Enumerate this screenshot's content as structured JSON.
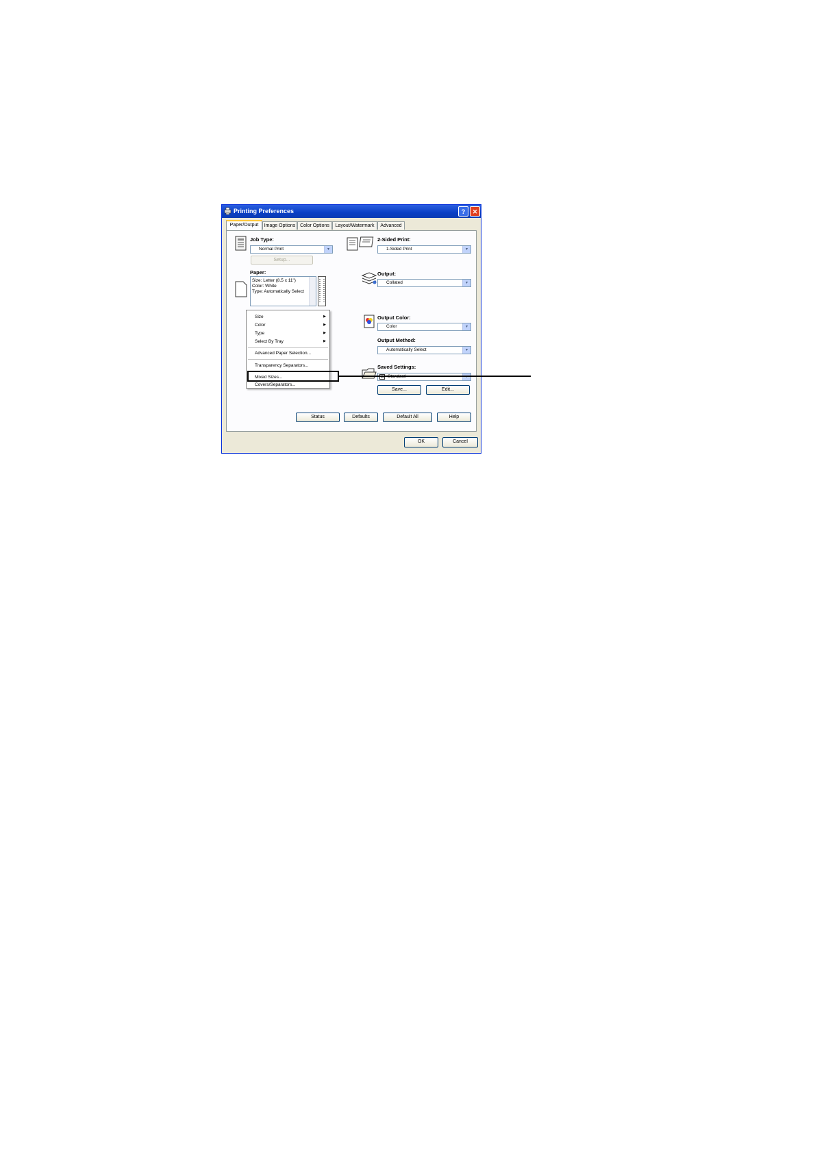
{
  "dialog": {
    "title": "Printing Preferences",
    "help_glyph": "?",
    "close_glyph": "✕"
  },
  "tabs": [
    {
      "label": "Paper/Output",
      "active": true
    },
    {
      "label": "Image Options"
    },
    {
      "label": "Color Options"
    },
    {
      "label": "Layout/Watermark"
    },
    {
      "label": "Advanced"
    }
  ],
  "job_type": {
    "label": "Job Type:",
    "value": "Normal Print",
    "setup_label": "Setup..."
  },
  "two_sided": {
    "label": "2-Sided Print:",
    "value": "1-Sided Print"
  },
  "paper": {
    "label": "Paper:",
    "lines": [
      "Size: Letter (8.5 x 11\")",
      "Color: White",
      "Type: Automatically Select"
    ]
  },
  "output": {
    "label": "Output:",
    "value": "Collated"
  },
  "output_color": {
    "label": "Output Color:",
    "value": "Color"
  },
  "output_method": {
    "label": "Output Method:",
    "value": "Automatically Select"
  },
  "saved_settings": {
    "label": "Saved Settings:",
    "value": "Standard",
    "badge": "A",
    "save_label": "Save...",
    "edit_label": "Edit..."
  },
  "context_menu": {
    "items": [
      {
        "label": "Size",
        "submenu": true
      },
      {
        "label": "Color",
        "submenu": true
      },
      {
        "label": "Type",
        "submenu": true
      },
      {
        "label": "Select By Tray",
        "submenu": true
      },
      {
        "label": "Advanced Paper Selection..."
      },
      {
        "label": "Transparency Separators..."
      },
      {
        "label": "Mixed Sizes...",
        "highlighted_callout": true
      },
      {
        "label": "Covers/Separators..."
      }
    ],
    "submenu_glyph": "▶"
  },
  "bottom_buttons": {
    "status": "Status",
    "defaults": "Defaults",
    "default_all": "Default All",
    "help": "Help"
  },
  "dialog_buttons": {
    "ok": "OK",
    "cancel": "Cancel"
  },
  "dropdown_glyph": "▾",
  "colors": {
    "titlebar": "#0a3fc4",
    "dialog_bg": "#ece9d8",
    "active_tab_accent": "#ffc83c"
  }
}
